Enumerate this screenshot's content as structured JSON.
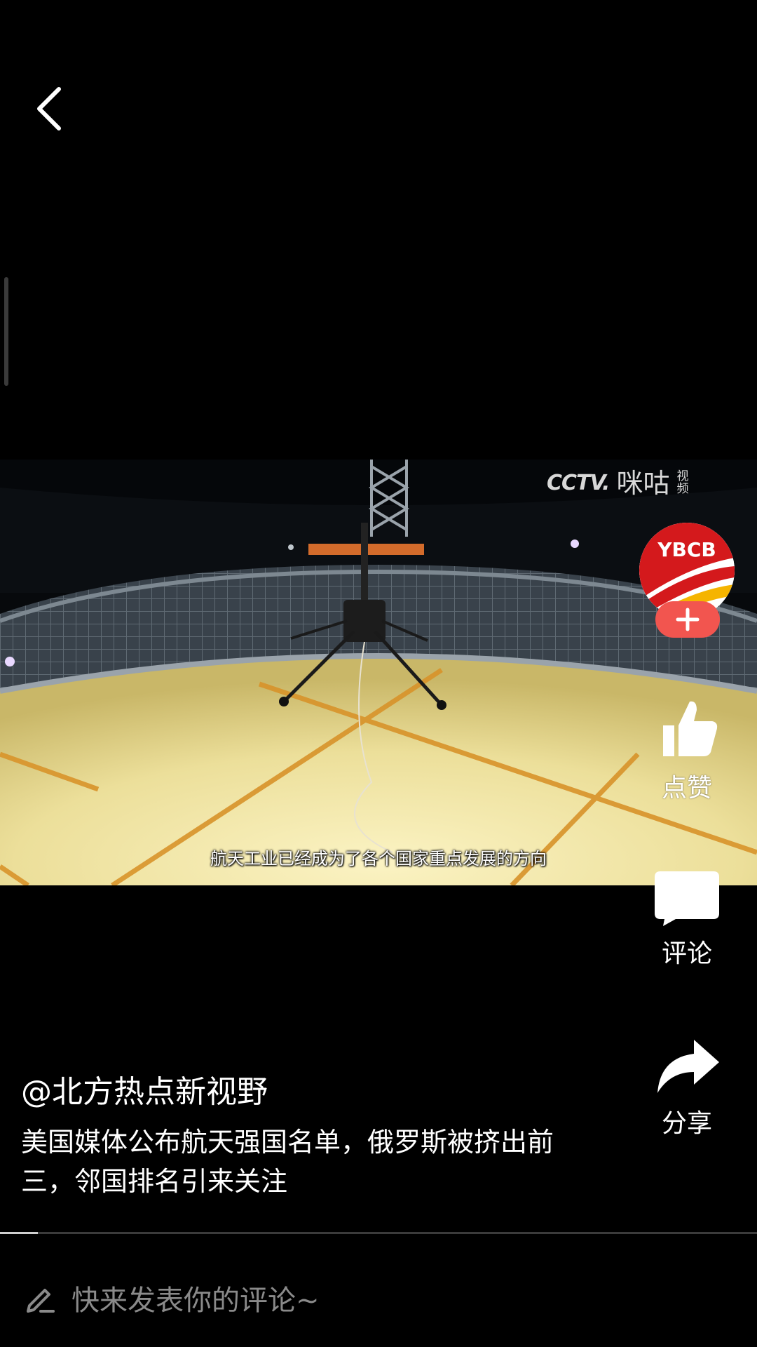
{
  "header": {
    "back_icon": "chevron-left-icon"
  },
  "video": {
    "watermark": {
      "cctv": "CCTV.",
      "cctv_sub": "",
      "migu": "咪咕",
      "tag": "视频"
    },
    "subtitle": "航天工业已经成为了各个国家重点发展的方向"
  },
  "actions": {
    "avatar_text": "YBCB",
    "follow_icon": "plus-icon",
    "like": {
      "label": "点赞",
      "icon": "thumbs-up-icon"
    },
    "comment": {
      "label": "评论",
      "icon": "comment-bubble-icon"
    },
    "share": {
      "label": "分享",
      "icon": "share-arrow-icon"
    }
  },
  "caption": {
    "author": "@北方热点新视野",
    "description": "美国媒体公布航天强国名单，俄罗斯被挤出前三，邻国排名引来关注"
  },
  "progress": {
    "percent": 5
  },
  "comment_bar": {
    "icon": "pen-icon",
    "placeholder": "快来发表你的评论~"
  },
  "colors": {
    "background": "#000000",
    "follow_button": "#f2554f",
    "avatar_red": "#d4191c",
    "avatar_yellow": "#f5b400",
    "placeholder_text": "#8a8a8a"
  }
}
